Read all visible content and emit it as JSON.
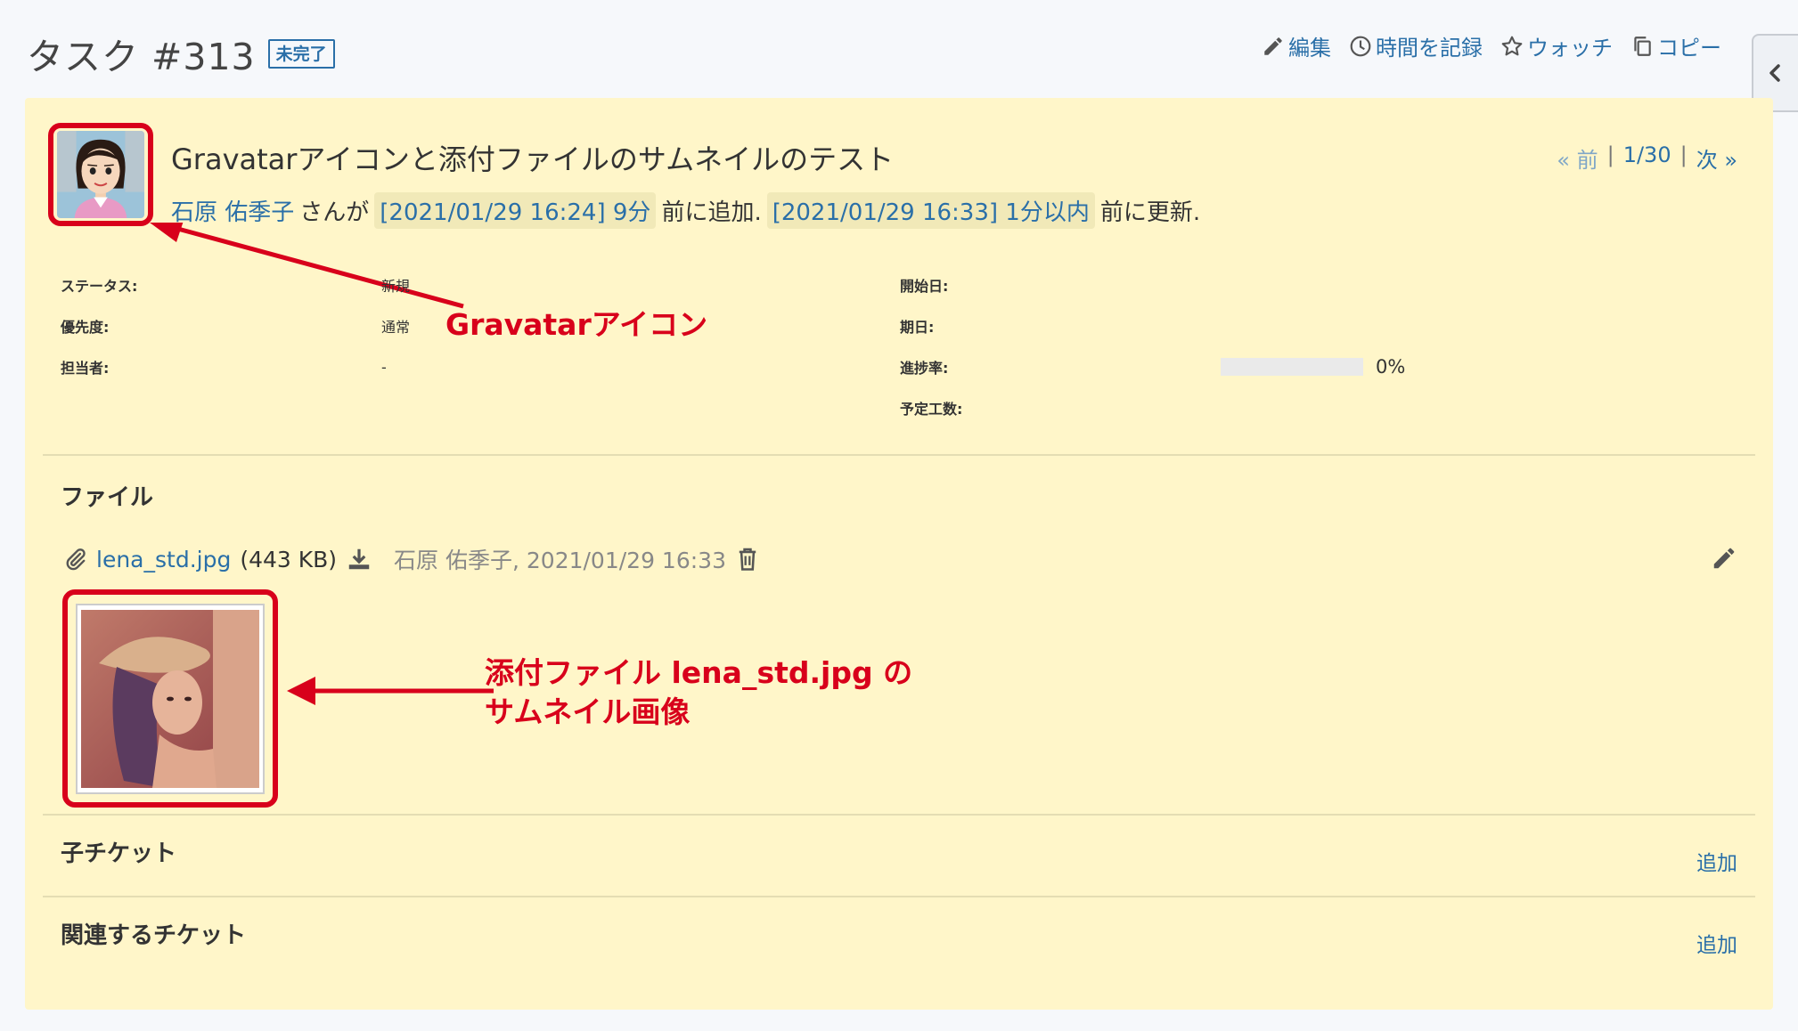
{
  "header": {
    "title": "タスク #313",
    "status_badge": "未完了",
    "actions": [
      {
        "label": "編集",
        "icon": "pencil-icon"
      },
      {
        "label": "時間を記録",
        "icon": "clock-icon"
      },
      {
        "label": "ウォッチ",
        "icon": "star-icon"
      },
      {
        "label": "コピー",
        "icon": "copy-icon"
      }
    ]
  },
  "issue": {
    "subject": "Gravatarアイコンと添付ファイルのサムネイルのテスト",
    "author": "石原 佑季子",
    "author_suffix": "さんが",
    "created_date": "[2021/01/29 16:24] 9分",
    "created_suffix": "前に追加.",
    "updated_date": "[2021/01/29 16:33] 1分以内",
    "updated_suffix": "前に更新.",
    "nav": {
      "prev": "« 前",
      "position": "1/30",
      "next": "次 »"
    },
    "attributes": {
      "status_label": "ステータス:",
      "status_value": "新規",
      "priority_label": "優先度:",
      "priority_value": "通常",
      "assignee_label": "担当者:",
      "assignee_value": "-",
      "start_label": "開始日:",
      "due_label": "期日:",
      "progress_label": "進捗率:",
      "progress_value": "0%",
      "progress_fraction": 0,
      "estimated_label": "予定工数:"
    }
  },
  "files": {
    "section_title": "ファイル",
    "items": [
      {
        "name": "lena_std.jpg",
        "size": "(443 KB)",
        "meta": "石原 佑季子, 2021/01/29 16:33"
      }
    ]
  },
  "subtasks": {
    "section_title": "子チケット",
    "add_label": "追加"
  },
  "relations": {
    "section_title": "関連するチケット",
    "add_label": "追加"
  },
  "annotations": {
    "gravatar": "Gravatarアイコン",
    "thumb_line1": "添付ファイル lena_std.jpg の",
    "thumb_line2": "サムネイル画像"
  },
  "colors": {
    "accent": "#2a6fa8",
    "panel": "#fff6c9",
    "annotation": "#d8001b"
  }
}
